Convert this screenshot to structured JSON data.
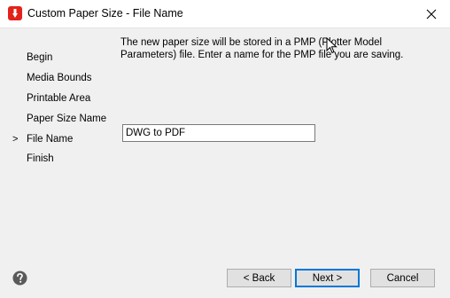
{
  "window": {
    "title": "Custom Paper Size - File Name"
  },
  "steps": [
    {
      "label": "Begin"
    },
    {
      "label": "Media Bounds"
    },
    {
      "label": "Printable Area"
    },
    {
      "label": "Paper Size Name"
    },
    {
      "label": "File Name"
    },
    {
      "label": "Finish"
    }
  ],
  "current_step_marker": ">",
  "description": "The new paper size will be stored in a PMP (Plotter Model Parameters) file. Enter a name for the PMP file you are saving.",
  "file_name_input": {
    "value": "DWG to PDF"
  },
  "buttons": {
    "back": "< Back",
    "next": "Next >",
    "cancel": "Cancel"
  },
  "icons": {
    "app": "autocad-app-icon",
    "close": "close-icon",
    "help": "help-icon"
  },
  "colors": {
    "app_icon": "#e2231a",
    "accent": "#0078d7"
  }
}
